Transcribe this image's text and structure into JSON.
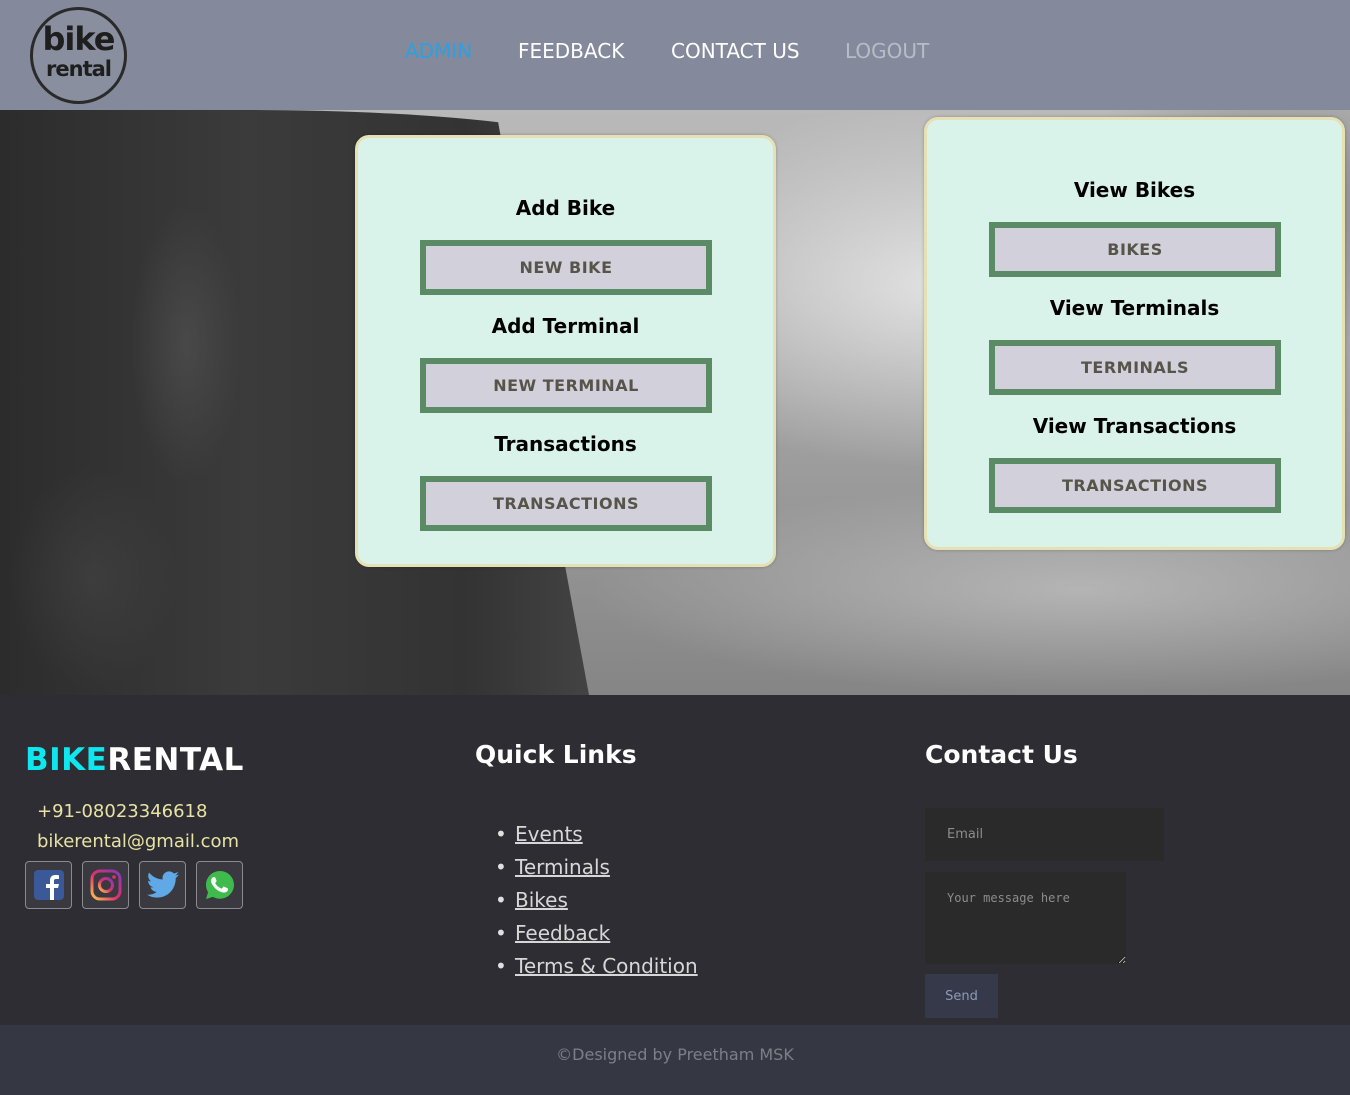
{
  "header": {
    "logo": {
      "line1": "bike",
      "line2": "rental"
    },
    "nav": {
      "admin": "ADMIN",
      "feedback": "FEEDBACK",
      "contact": "CONTACT US",
      "logout": "LOGOUT"
    },
    "active_color": "#2e9fe0"
  },
  "left_card": {
    "add_bike_title": "Add Bike",
    "new_bike_button": "NEW BIKE",
    "add_terminal_title": "Add Terminal",
    "new_terminal_button": "NEW TERMINAL",
    "transactions_title": "Transactions",
    "transactions_button": "TRANSACTIONS"
  },
  "right_card": {
    "view_bikes_title": "View Bikes",
    "bikes_button": "BIKES",
    "view_terminals_title": "View Terminals",
    "terminals_button": "TERMINALS",
    "view_transactions_title": "View Transactions",
    "transactions_button": "TRANSACTIONS"
  },
  "footer": {
    "brand_part1": "BIKE",
    "brand_part2": "RENTAL",
    "phone": "+91-08023346618",
    "email": "bikerental@gmail.com",
    "social_icons": [
      "facebook-icon",
      "instagram-icon",
      "twitter-icon",
      "whatsapp-icon"
    ],
    "quick_links_title": "Quick Links",
    "quick_links": [
      "Events",
      "Terminals",
      "Bikes",
      "Feedback",
      "Terms & Condition"
    ],
    "contact_title": "Contact Us",
    "email_placeholder": "Email",
    "message_placeholder": "Your message here",
    "send_label": "Send",
    "copyright": "©Designed by Preetham MSK"
  },
  "colors": {
    "header_bg": "#848a9b",
    "card_bg": "#d9f2ea",
    "button_border": "#5a8b64",
    "brand_accent": "#10e6ee",
    "footer_bg": "#2e2d33"
  }
}
